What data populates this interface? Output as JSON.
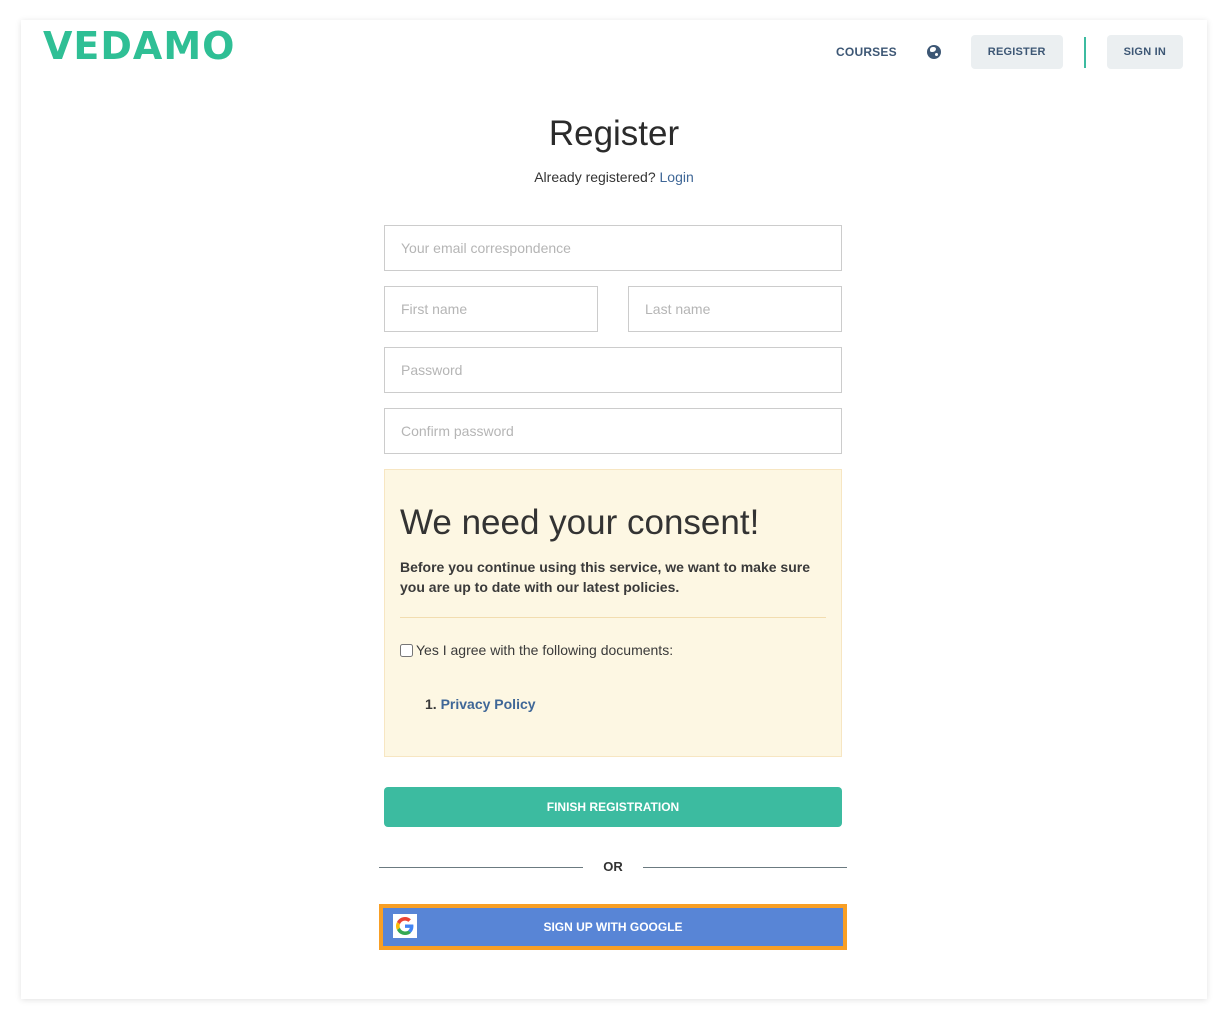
{
  "header": {
    "logo": "VEDAMO",
    "nav": {
      "courses_label": "COURSES",
      "language_icon": "globe-icon",
      "register_label": "REGISTER",
      "signin_label": "SIGN IN"
    }
  },
  "page": {
    "title": "Register",
    "already_registered_text": "Already registered?",
    "login_link": "Login"
  },
  "form": {
    "email_placeholder": "Your email correspondence",
    "first_name_placeholder": "First name",
    "last_name_placeholder": "Last name",
    "password_placeholder": "Password",
    "confirm_password_placeholder": "Confirm password",
    "email_value": "",
    "first_name_value": "",
    "last_name_value": "",
    "password_value": "",
    "confirm_password_value": ""
  },
  "consent": {
    "title": "We need your consent!",
    "text": "Before you continue using this service, we want to make sure you are up to date with our latest policies.",
    "agree_label": "Yes I agree with the following documents:",
    "agree_checked": false,
    "documents": [
      {
        "number": "1.",
        "label": "Privacy Policy"
      }
    ]
  },
  "actions": {
    "finish_label": "FINISH REGISTRATION",
    "or_label": "OR",
    "google_label": "SIGN UP WITH GOOGLE",
    "google_icon": "google-icon"
  },
  "colors": {
    "brand": "#2fbf95",
    "primary_button": "#3cbba0",
    "google_button": "#5885d6",
    "focus_outline": "#f89f25",
    "link": "#3f6797",
    "nav_text": "#3d5775",
    "consent_bg": "#fdf7e3"
  }
}
